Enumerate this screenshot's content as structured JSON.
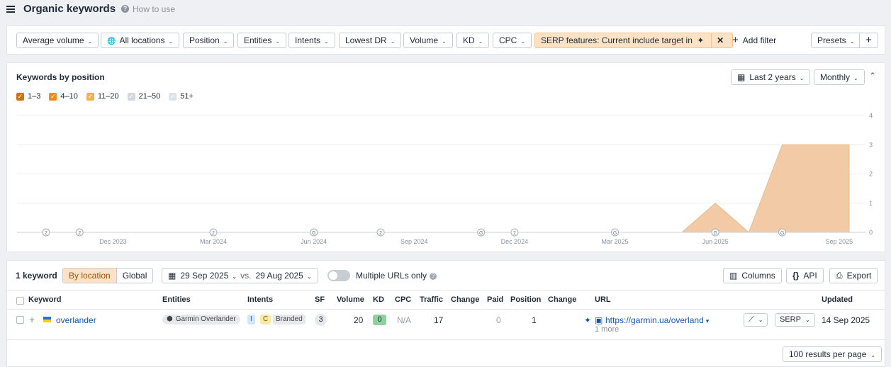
{
  "header": {
    "title": "Organic keywords",
    "help": "How to use"
  },
  "filters": [
    {
      "label": "Average volume",
      "x": 13
    },
    {
      "label": "All locations",
      "x": 132,
      "globe": true
    },
    {
      "label": "Position",
      "x": 248
    },
    {
      "label": "Entities",
      "x": 325
    },
    {
      "label": "Intents",
      "x": 397
    },
    {
      "label": "Lowest DR",
      "x": 468
    },
    {
      "label": "Volume",
      "x": 559
    },
    {
      "label": "KD",
      "x": 634
    },
    {
      "label": "CPC",
      "x": 685
    }
  ],
  "serp_filter": {
    "label": "SERP features: Current include target in"
  },
  "add_filter": "Add filter",
  "presets": "Presets",
  "chart": {
    "title": "Keywords by position",
    "range": "Last 2 years",
    "interval": "Monthly",
    "legend": [
      {
        "label": "1–3",
        "color": "#c8760d",
        "checked": true
      },
      {
        "label": "4–10",
        "color": "#f08a1c",
        "checked": true
      },
      {
        "label": "11–20",
        "color": "#f6b052",
        "checked": true
      },
      {
        "label": "21–50",
        "color": "#d4d8de",
        "checked": true
      },
      {
        "label": "51+",
        "color": "#dfe2e6",
        "checked": true
      }
    ]
  },
  "chart_data": {
    "type": "area",
    "x_labels": [
      "Dec 2023",
      "Mar 2024",
      "Jun 2024",
      "Sep 2024",
      "Dec 2024",
      "Mar 2025",
      "Jun 2025",
      "Sep 2025"
    ],
    "x": [
      "Oct 2023",
      "Nov 2023",
      "Dec 2023",
      "Jan 2024",
      "Feb 2024",
      "Mar 2024",
      "Apr 2024",
      "May 2024",
      "Jun 2024",
      "Jul 2024",
      "Aug 2024",
      "Sep 2024",
      "Oct 2024",
      "Nov 2024",
      "Dec 2024",
      "Jan 2025",
      "Feb 2025",
      "Mar 2025",
      "Apr 2025",
      "May 2025",
      "Jun 2025",
      "Jul 2025",
      "Aug 2025",
      "Sep 2025",
      "Sep 2025"
    ],
    "series": [
      {
        "name": "11–20",
        "values": [
          0,
          0,
          0,
          0,
          0,
          0,
          0,
          0,
          0,
          0,
          0,
          0,
          0,
          0,
          0,
          0,
          0,
          0,
          0,
          0,
          1,
          0,
          3,
          3,
          3
        ]
      }
    ],
    "ylim": [
      0,
      4
    ],
    "y_ticks": [
      "0",
      "1",
      "2",
      "3",
      "4"
    ],
    "markers": [
      {
        "x": "Oct 2023",
        "label": "2"
      },
      {
        "x": "Nov 2023",
        "label": "2"
      },
      {
        "x": "Mar 2024",
        "label": "2"
      },
      {
        "x": "Jun 2024",
        "label": "G"
      },
      {
        "x": "Aug 2024",
        "label": "2"
      },
      {
        "x": "Nov 2024",
        "label": "G"
      },
      {
        "x": "Dec 2024",
        "label": "2"
      },
      {
        "x": "Mar 2025",
        "label": "G"
      },
      {
        "x": "Jun 2025",
        "label": "G"
      },
      {
        "x": "Aug 2025",
        "label": "G"
      }
    ]
  },
  "table": {
    "count": "1 keyword",
    "seg_by_location": "By location",
    "seg_global": "Global",
    "date_from": "29 Sep 2025",
    "vs": "vs.",
    "date_to": "29 Aug 2025",
    "multiple_urls": "Multiple URLs only",
    "columns_btn": "Columns",
    "api_btn": "API",
    "export_btn": "Export",
    "headers": {
      "keyword": "Keyword",
      "entities": "Entities",
      "intents": "Intents",
      "sf": "SF",
      "volume": "Volume",
      "kd": "KD",
      "cpc": "CPC",
      "traffic": "Traffic",
      "change": "Change",
      "paid": "Paid",
      "position": "Position",
      "change2": "Change",
      "url": "URL",
      "updated": "Updated"
    },
    "row": {
      "keyword": "overlander",
      "entity": "Garmin Overlander",
      "intent_i": "I",
      "intent_c": "C",
      "intent_branded": "Branded",
      "sf": "3",
      "volume": "20",
      "kd": "0",
      "cpc": "N/A",
      "traffic": "17",
      "paid": "0",
      "position": "1",
      "url": "https://garmin.ua/overland",
      "more": "1 more",
      "serp_btn": "SERP",
      "updated": "14 Sep 2025"
    },
    "per_page": "100 results per page"
  }
}
